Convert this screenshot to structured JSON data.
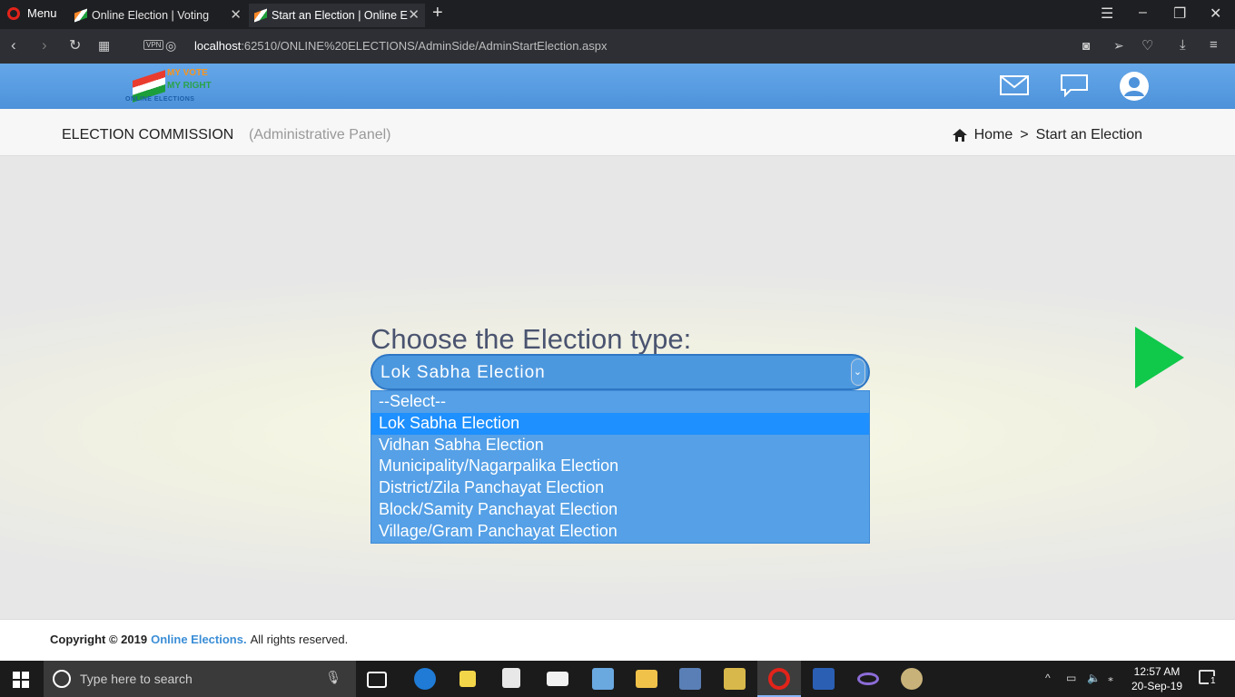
{
  "browser": {
    "menu_label": "Menu",
    "tabs": [
      {
        "title": "Online Election | Voting"
      },
      {
        "title": "Start an Election | Online El"
      }
    ],
    "url_host": "localhost",
    "url_rest": ":62510/ONLINE%20ELECTIONS/AdminSide/AdminStartElection.aspx",
    "vpn_label": "VPN"
  },
  "logo": {
    "line1": "MY VOTE",
    "line2": "MY RIGHT",
    "line3": "ONLINE ELECTIONS"
  },
  "subheader": {
    "org": "ELECTION COMMISSION",
    "panel": "(Administrative Panel)",
    "breadcrumb": {
      "home": "Home",
      "separator": ">",
      "current": "Start an Election"
    }
  },
  "main": {
    "prompt": "Choose the Election type:",
    "selected": "Lok Sabha Election",
    "options": [
      "--Select--",
      "Lok Sabha Election",
      "Vidhan Sabha Election",
      "Municipality/Nagarpalika Election",
      "District/Zila Panchayat Election",
      "Block/Samity Panchayat Election",
      "Village/Gram Panchayat Election"
    ],
    "highlighted_index": 1,
    "play_color": "#10c84a"
  },
  "footer": {
    "copyright": "Copyright © 2019",
    "brand": "Online Elections.",
    "rights": "All rights reserved."
  },
  "taskbar": {
    "search_placeholder": "Type here to search",
    "time": "12:57 AM",
    "date": "20-Sep-19",
    "notification_count": "1"
  }
}
